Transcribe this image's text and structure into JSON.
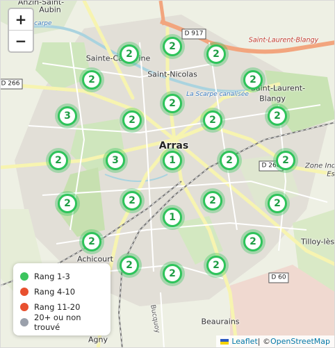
{
  "zoom": {
    "in_label": "+",
    "out_label": "−"
  },
  "places": {
    "anzin": "Anzin-Saint-",
    "aubin": "Aubin",
    "sainte_catherine": "Sainte-Catherine",
    "saint_nicolas": "Saint-Nicolas",
    "saint_laurent_blangy_top": "Saint-Laurent-Blangy",
    "saint_laurent": "Saint-Laurent-",
    "blangy": "Blangy",
    "arras": "Arras",
    "achicourt": "Achicourt",
    "tilloy": "Tilloy-lès-",
    "beaurains": "Beaurains",
    "agny": "Agny",
    "zone_ind": "Zone Ind",
    "zone_ind_2": "Es",
    "scarpe": "Scarpe",
    "scarpe_canal": "La Scarpe canalisée",
    "rue_bucquoy": "Bucquoy"
  },
  "roads": {
    "d917": "D 917",
    "d266": "D 266",
    "d260": "D 260",
    "d60": "D 60"
  },
  "markers": [
    {
      "label": "2"
    },
    {
      "label": "2"
    },
    {
      "label": "2"
    },
    {
      "label": "2"
    },
    {
      "label": "2"
    },
    {
      "label": "2"
    },
    {
      "label": "3"
    },
    {
      "label": "2"
    },
    {
      "label": "2"
    },
    {
      "label": "2"
    },
    {
      "label": "2"
    },
    {
      "label": "3"
    },
    {
      "label": "1"
    },
    {
      "label": "2"
    },
    {
      "label": "2"
    },
    {
      "label": "2"
    },
    {
      "label": "2"
    },
    {
      "label": "2"
    },
    {
      "label": "2"
    },
    {
      "label": "1"
    },
    {
      "label": "2"
    },
    {
      "label": "2"
    },
    {
      "label": "2"
    },
    {
      "label": "2"
    },
    {
      "label": "2"
    }
  ],
  "legend": [
    {
      "label": "Rang 1-3",
      "color": "#3cc45e"
    },
    {
      "label": "Rang 4-10",
      "color": "#e8502f"
    },
    {
      "label": "Rang 11-20",
      "color": "#e8502f"
    },
    {
      "label": "20+ ou non trouvé",
      "color": "#9aa0ab"
    }
  ],
  "attribution": {
    "leaflet": "Leaflet",
    "sep": " | © ",
    "osm": "OpenStreetMap"
  }
}
